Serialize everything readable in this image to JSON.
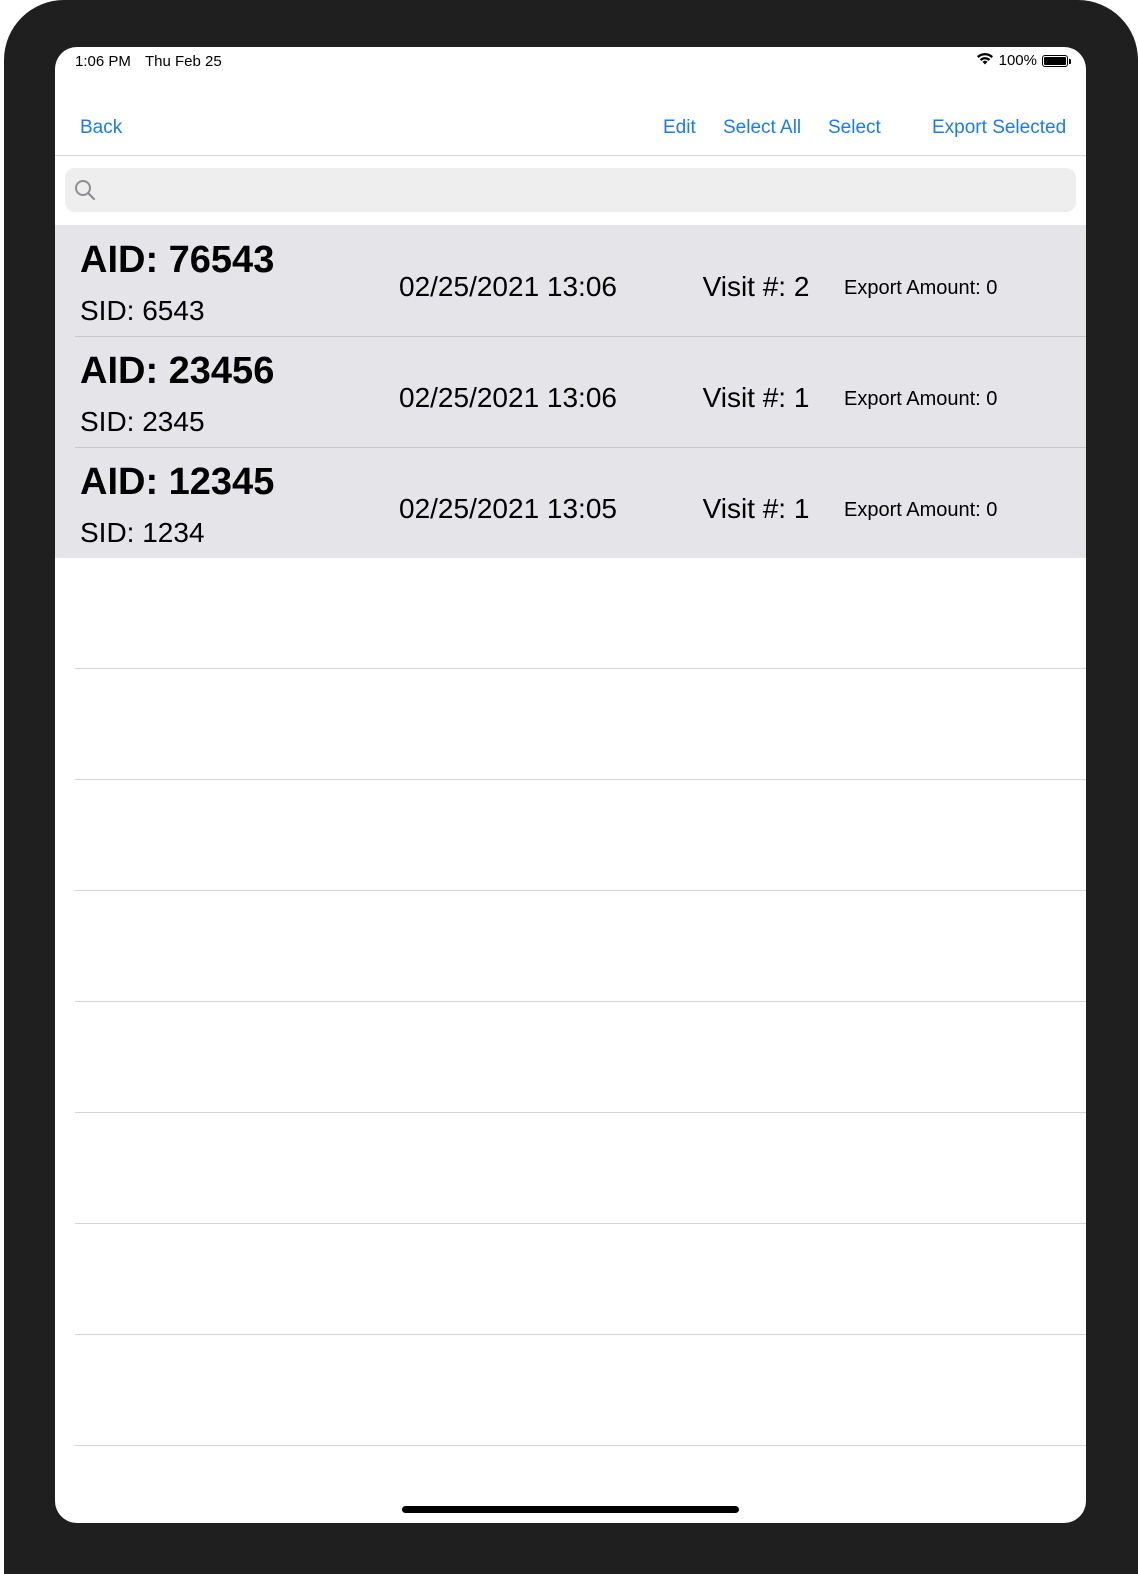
{
  "status_bar": {
    "time": "1:06 PM",
    "date": "Thu Feb 25",
    "battery": "100%"
  },
  "nav": {
    "back": "Back",
    "edit": "Edit",
    "select_all": "Select All",
    "select": "Select",
    "export_selected": "Export Selected",
    "accent_color": "#1a7bf0"
  },
  "search": {
    "placeholder": "",
    "value": ""
  },
  "records": [
    {
      "aid": "AID: 76543",
      "sid": "SID: 6543",
      "datetime": "02/25/2021 13:06",
      "visit": "Visit #: 2",
      "export": "Export Amount: 0"
    },
    {
      "aid": "AID: 23456",
      "sid": "SID: 2345",
      "datetime": "02/25/2021 13:06",
      "visit": "Visit #: 1",
      "export": "Export Amount: 0"
    },
    {
      "aid": "AID: 12345",
      "sid": "SID: 1234",
      "datetime": "02/25/2021 13:05",
      "visit": "Visit #: 1",
      "export": "Export Amount: 0"
    }
  ]
}
